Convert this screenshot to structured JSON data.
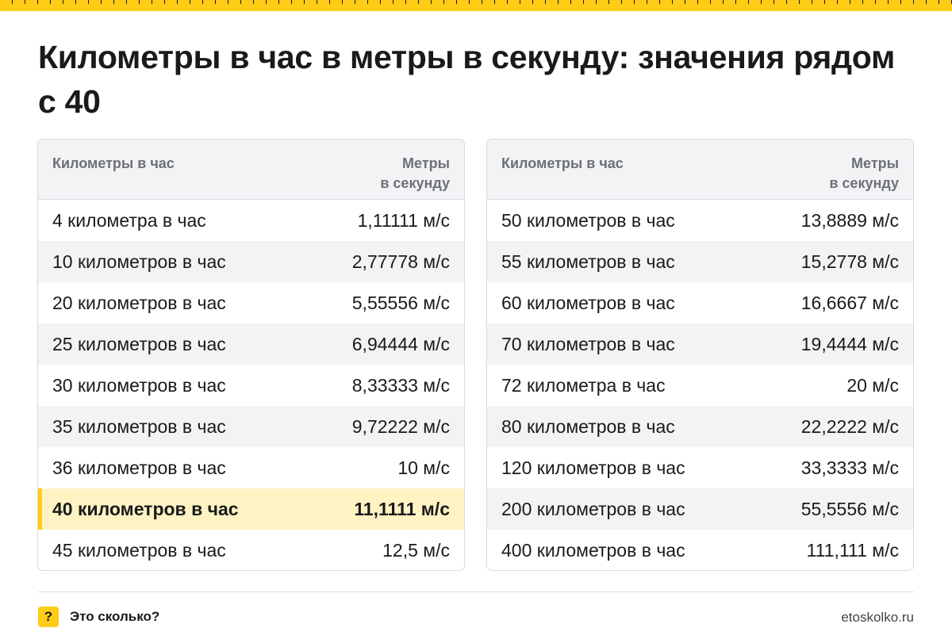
{
  "title": "Километры в час в метры в секунду: значения рядом с 40",
  "colors": {
    "accent": "#ffcc16",
    "highlight": "#fff3c4",
    "header_bg": "#f2f3f5"
  },
  "table_left": {
    "col1_header": "Километры в час",
    "col2_header": "Метры\nв секунду",
    "rows": [
      {
        "kmh": "4 километра в час",
        "ms": "1,11111 м/с"
      },
      {
        "kmh": "10 километров в час",
        "ms": "2,77778 м/с"
      },
      {
        "kmh": "20 километров в час",
        "ms": "5,55556 м/с"
      },
      {
        "kmh": "25 километров в час",
        "ms": "6,94444 м/с"
      },
      {
        "kmh": "30 километров в час",
        "ms": "8,33333 м/с"
      },
      {
        "kmh": "35 километров в час",
        "ms": "9,72222 м/с"
      },
      {
        "kmh": "36 километров в час",
        "ms": "10 м/с"
      },
      {
        "kmh": "40 километров в час",
        "ms": "11,1111 м/с"
      },
      {
        "kmh": "45 километров в час",
        "ms": "12,5 м/с"
      }
    ]
  },
  "table_right": {
    "col1_header": "Километры в час",
    "col2_header": "Метры\nв секунду",
    "rows": [
      {
        "kmh": "50 километров в час",
        "ms": "13,8889 м/с"
      },
      {
        "kmh": "55 километров в час",
        "ms": "15,2778 м/с"
      },
      {
        "kmh": "60 километров в час",
        "ms": "16,6667 м/с"
      },
      {
        "kmh": "70 километров в час",
        "ms": "19,4444 м/с"
      },
      {
        "kmh": "72 километра в час",
        "ms": "20 м/с"
      },
      {
        "kmh": "80 километров в час",
        "ms": "22,2222 м/с"
      },
      {
        "kmh": "120 километров в час",
        "ms": "33,3333 м/с"
      },
      {
        "kmh": "200 километров в час",
        "ms": "55,5556 м/с"
      },
      {
        "kmh": "400 километров в час",
        "ms": "111,111 м/с"
      }
    ]
  },
  "footer": {
    "icon": "question-mark-icon",
    "icon_glyph": "?",
    "brand": "Это сколько?",
    "site": "etoskolko.ru"
  }
}
